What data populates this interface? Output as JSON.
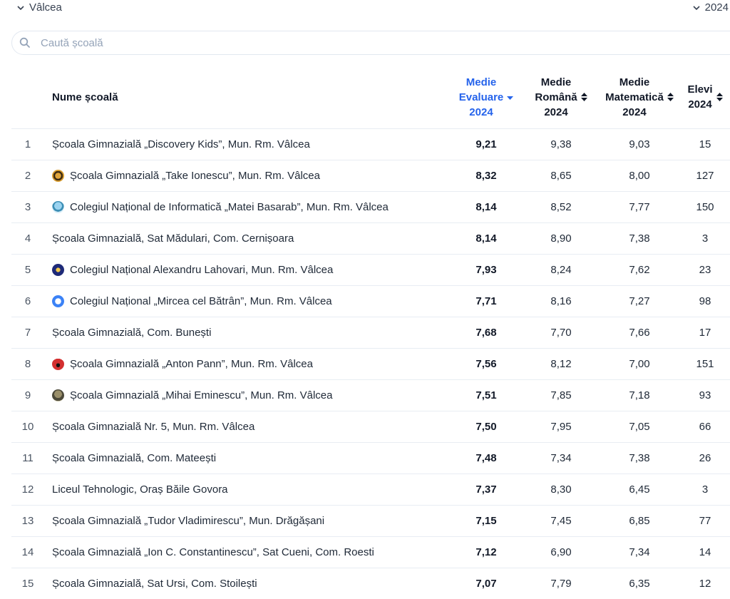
{
  "header": {
    "county": "Vâlcea",
    "year": "2024"
  },
  "search": {
    "placeholder": "Caută școală"
  },
  "colors": {
    "accent": "#2563eb",
    "border": "#e8edf3",
    "muted": "#94a3b8"
  },
  "table": {
    "columns": {
      "name": "Nume școală",
      "evaluare": [
        "Medie",
        "Evaluare",
        "2024"
      ],
      "romana": [
        "Medie",
        "Română",
        "2024"
      ],
      "matematica": [
        "Medie",
        "Matematică",
        "2024"
      ],
      "elevi": [
        "Elevi",
        "2024"
      ]
    },
    "rows": [
      {
        "rank": "1",
        "name": "Școala Gimnazială „Discovery Kids”, Mun. Rm. Vâlcea",
        "logo": "",
        "evaluare": "9,21",
        "romana": "9,38",
        "matematica": "9,03",
        "elevi": "15"
      },
      {
        "rank": "2",
        "name": "Școala Gimnazială „Take Ionescu”, Mun. Rm. Vâlcea",
        "logo": "school-crest-icon-gold",
        "evaluare": "8,32",
        "romana": "8,65",
        "matematica": "8,00",
        "elevi": "127"
      },
      {
        "rank": "3",
        "name": "Colegiul Național de Informatică „Matei Basarab”, Mun. Rm. Vâlcea",
        "logo": "school-crest-icon-blue-light",
        "evaluare": "8,14",
        "romana": "8,52",
        "matematica": "7,77",
        "elevi": "150"
      },
      {
        "rank": "4",
        "name": "Școala Gimnazială, Sat Mădulari, Com. Cernișoara",
        "logo": "",
        "evaluare": "8,14",
        "romana": "8,90",
        "matematica": "7,38",
        "elevi": "3"
      },
      {
        "rank": "5",
        "name": "Colegiul Național Alexandru Lahovari, Mun. Rm. Vâlcea",
        "logo": "school-crest-icon-navy",
        "evaluare": "7,93",
        "romana": "8,24",
        "matematica": "7,62",
        "elevi": "23"
      },
      {
        "rank": "6",
        "name": "Colegiul Național „Mircea cel Bătrân”, Mun. Rm. Vâlcea",
        "logo": "school-crest-icon-blue",
        "evaluare": "7,71",
        "romana": "8,16",
        "matematica": "7,27",
        "elevi": "98"
      },
      {
        "rank": "7",
        "name": "Școala Gimnazială, Com. Bunești",
        "logo": "",
        "evaluare": "7,68",
        "romana": "7,70",
        "matematica": "7,66",
        "elevi": "17"
      },
      {
        "rank": "8",
        "name": "Școala Gimnazială „Anton Pann”, Mun. Rm. Vâlcea",
        "logo": "school-crest-icon-red",
        "evaluare": "7,56",
        "romana": "8,12",
        "matematica": "7,00",
        "elevi": "151"
      },
      {
        "rank": "9",
        "name": "Școala Gimnazială „Mihai Eminescu”, Mun. Rm. Vâlcea",
        "logo": "school-crest-icon-portrait",
        "evaluare": "7,51",
        "romana": "7,85",
        "matematica": "7,18",
        "elevi": "93"
      },
      {
        "rank": "10",
        "name": "Școala Gimnazială Nr. 5, Mun. Rm. Vâlcea",
        "logo": "",
        "evaluare": "7,50",
        "romana": "7,95",
        "matematica": "7,05",
        "elevi": "66"
      },
      {
        "rank": "11",
        "name": "Școala Gimnazială, Com. Mateești",
        "logo": "",
        "evaluare": "7,48",
        "romana": "7,34",
        "matematica": "7,38",
        "elevi": "26"
      },
      {
        "rank": "12",
        "name": "Liceul Tehnologic, Oraș Băile Govora",
        "logo": "",
        "evaluare": "7,37",
        "romana": "8,30",
        "matematica": "6,45",
        "elevi": "3"
      },
      {
        "rank": "13",
        "name": "Școala Gimnazială „Tudor Vladimirescu”, Mun. Drăgășani",
        "logo": "",
        "evaluare": "7,15",
        "romana": "7,45",
        "matematica": "6,85",
        "elevi": "77"
      },
      {
        "rank": "14",
        "name": "Școala Gimnazială „Ion C. Constantinescu”, Sat Cueni, Com. Roesti",
        "logo": "",
        "evaluare": "7,12",
        "romana": "6,90",
        "matematica": "7,34",
        "elevi": "14"
      },
      {
        "rank": "15",
        "name": "Școala Gimnazială, Sat Ursi, Com. Stoilești",
        "logo": "",
        "evaluare": "7,07",
        "romana": "7,79",
        "matematica": "6,35",
        "elevi": "12"
      }
    ]
  }
}
